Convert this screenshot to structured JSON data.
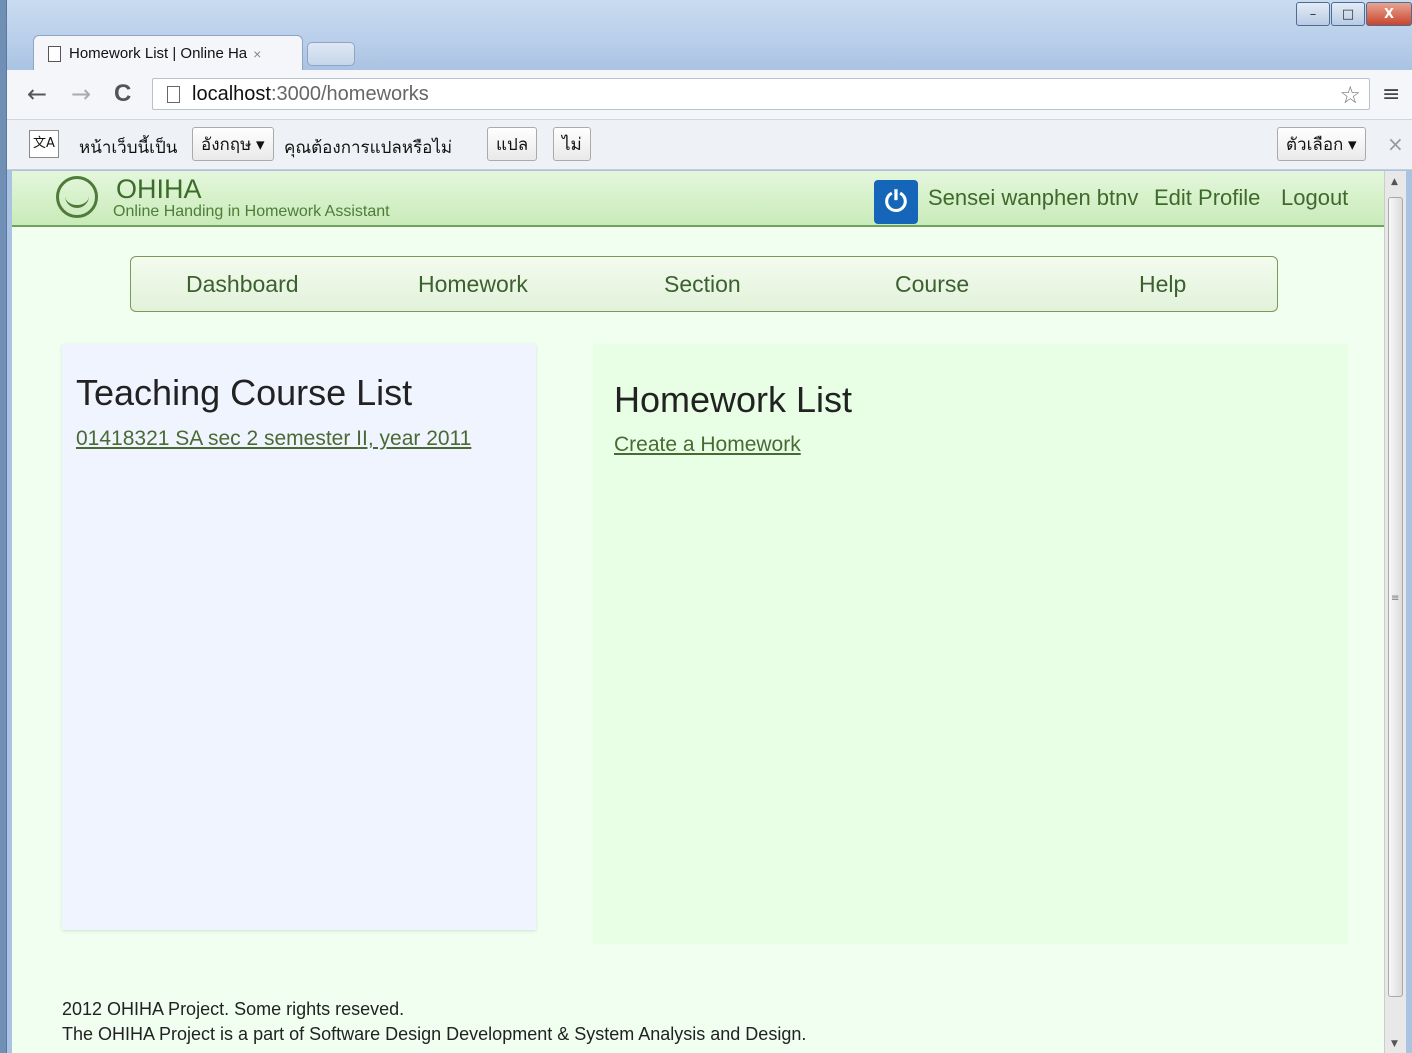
{
  "browser": {
    "tab_title": "Homework List | Online Ha",
    "tab_close": "×",
    "url_host": "localhost",
    "url_path": ":3000/homeworks",
    "back": "←",
    "forward": "→",
    "reload": "C",
    "star": "☆",
    "menu": "≡"
  },
  "window_controls": {
    "minimize": "–",
    "maximize": "□",
    "close": "X"
  },
  "translate_bar": {
    "icon": "文A",
    "page_is": "หน้าเว็บนี้เป็น",
    "language": "อังกฤษ ▾",
    "question": "คุณต้องการแปลหรือไม่",
    "translate": "แปล",
    "no": "ไม่",
    "options": "ตัวเลือก ▾",
    "close": "×"
  },
  "header": {
    "logo_title": "OHIHA",
    "logo_subtitle": "Online Handing in Homework Assistant",
    "power_icon": "⏻",
    "user": "Sensei wanphen btnv",
    "edit_profile": "Edit Profile",
    "logout": "Logout"
  },
  "nav": [
    "Dashboard",
    "Homework",
    "Section",
    "Course",
    "Help"
  ],
  "left_panel": {
    "title": "Teaching Course List",
    "course": "01418321 SA sec 2 semester II, year 2011"
  },
  "right_panel": {
    "title": "Homework List",
    "create": "Create a Homework"
  },
  "footer": {
    "line1": "2012 OHIHA Project. Some rights reseved.",
    "line2": "The OHIHA Project is a part of Software Design Development & System Analysis and Design."
  },
  "scrollbar": {
    "up": "▲",
    "down": "▼",
    "grip": "≡"
  }
}
